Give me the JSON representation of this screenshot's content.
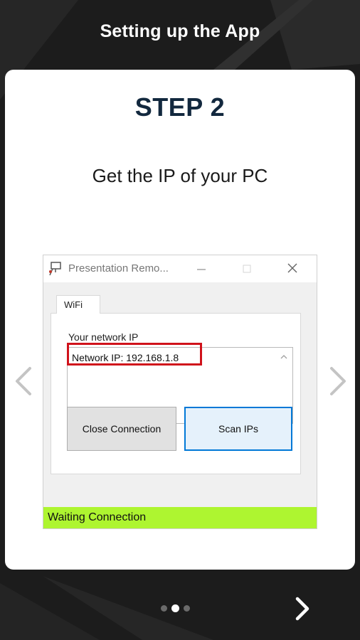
{
  "header": {
    "title": "Setting up the App"
  },
  "card": {
    "step_title": "STEP 2",
    "description": "Get the IP of your PC"
  },
  "window": {
    "title": "Presentation Remo...",
    "tab_label": "WiFi",
    "network_label": "Your network IP",
    "ip_text": "Network IP: 192.168.1.8",
    "close_button_label": "Close Connection",
    "scan_button_label": "Scan IPs",
    "status_text": "Waiting Connection"
  },
  "pager": {
    "total": 3,
    "active_index": 1
  },
  "colors": {
    "background": "#1c1c1c",
    "step_title": "#12283e",
    "status_bar": "#aef530",
    "highlight": "#d0121b",
    "scan_border": "#0078d7"
  },
  "icons": {
    "prev": "chevron-left-icon",
    "next": "chevron-right-icon",
    "bottom_next": "chevron-right-icon",
    "app": "presentation-remote-app-icon"
  }
}
